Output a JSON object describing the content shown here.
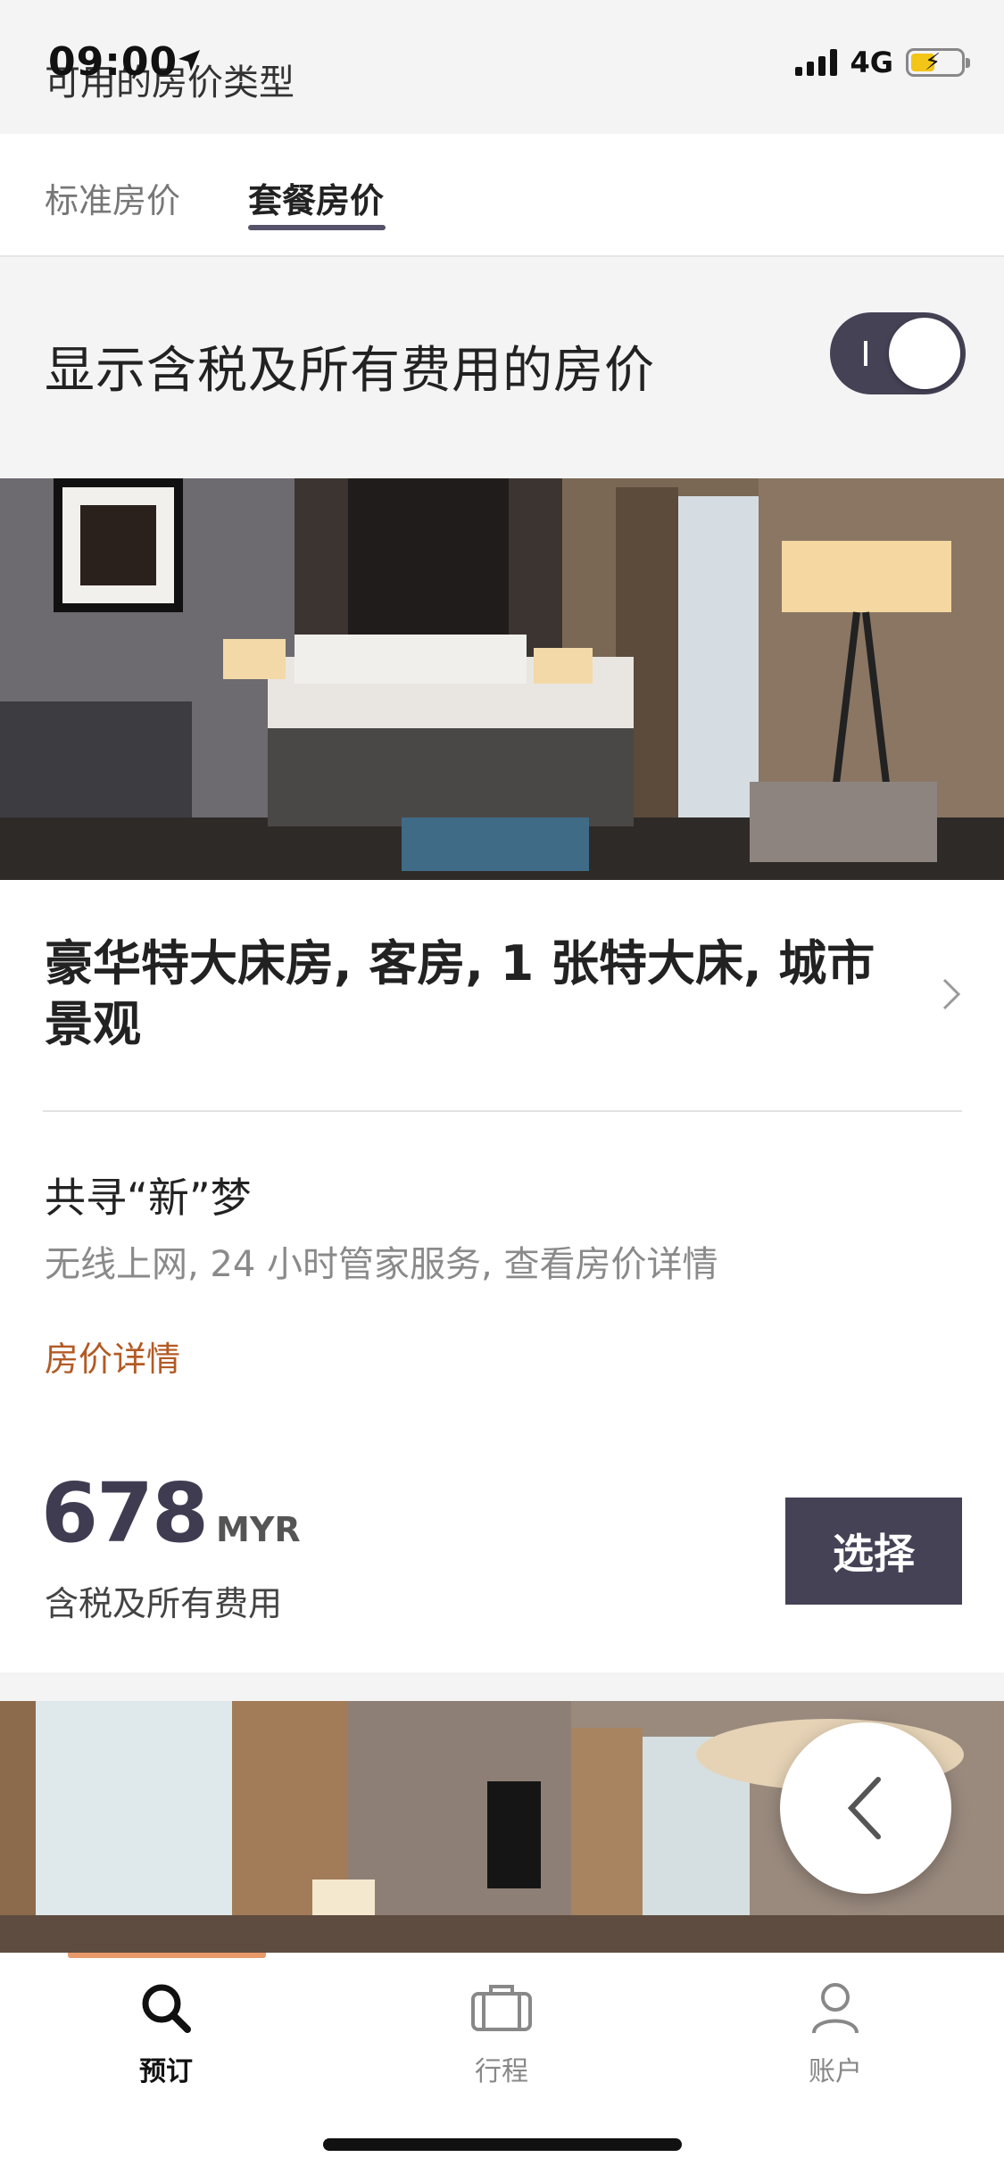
{
  "status_bar": {
    "time": "09:00",
    "network": "4G"
  },
  "header": {
    "title": "可用的房价类型"
  },
  "tabs": [
    {
      "label": "标准房价",
      "active": false
    },
    {
      "label": "套餐房价",
      "active": true
    }
  ],
  "tax_toggle": {
    "label": "显示含税及所有费用的房价",
    "on": true
  },
  "room": {
    "title": "豪华特大床房, 客房, 1  张特大床, 城市景观",
    "promo_name": "共寻“新”梦",
    "amenities": "无线上网, 24 小时管家服务,  查看房价详情",
    "rate_details_link": "房价详情",
    "price": "678",
    "currency": "MYR",
    "price_note": "含税及所有费用",
    "select_label": "选择"
  },
  "bottom_nav": [
    {
      "label": "预订",
      "icon": "search-icon",
      "active": true
    },
    {
      "label": "行程",
      "icon": "briefcase-icon",
      "active": false
    },
    {
      "label": "账户",
      "icon": "person-icon",
      "active": false
    }
  ],
  "colors": {
    "accent_dark": "#454256",
    "link": "#b35a24",
    "nav_accent": "#e89a6a"
  }
}
